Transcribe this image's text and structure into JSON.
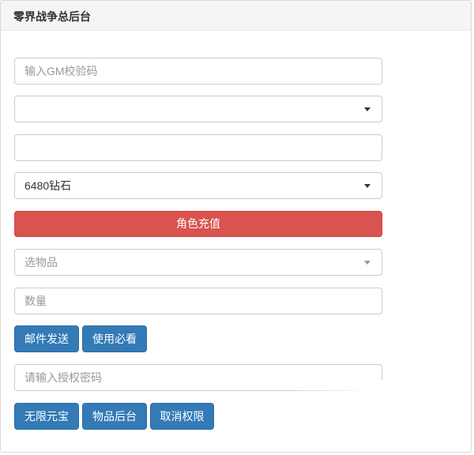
{
  "panel": {
    "title": "零界战争总后台"
  },
  "form": {
    "gm_code_placeholder": "输入GM校验码",
    "server_select_value": "",
    "role_input_value": "",
    "recharge_select_value": "6480钻石",
    "recharge_button": "角色充值",
    "item_select_placeholder": "选物品",
    "quantity_placeholder": "数量",
    "mail_send_button": "邮件发送",
    "usage_button": "使用必看",
    "auth_password_placeholder": "请输入授权密码",
    "unlimited_gem_button": "无限元宝",
    "item_backend_button": "物品后台",
    "revoke_button": "取消权限"
  },
  "colors": {
    "danger": "#d9534f",
    "primary": "#337ab7",
    "heading_bg": "#f5f5f5"
  }
}
